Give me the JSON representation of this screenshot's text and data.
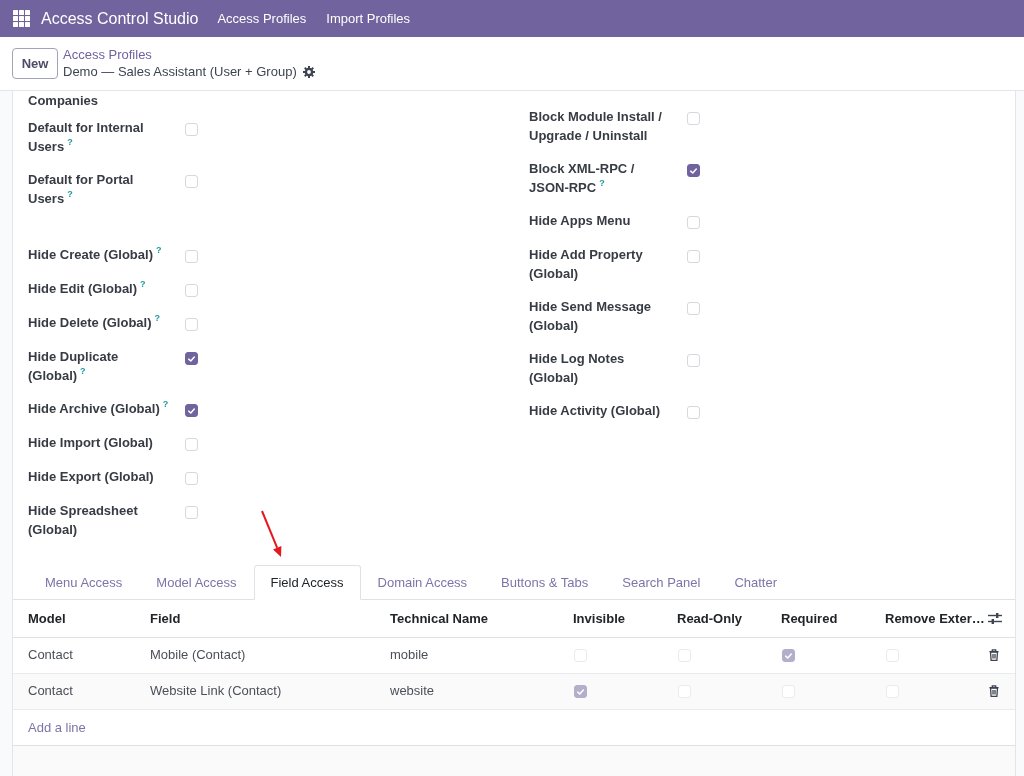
{
  "navbar": {
    "app_name": "Access Control Studio",
    "menu": [
      {
        "label": "Access Profiles"
      },
      {
        "label": "Import Profiles"
      }
    ]
  },
  "control_panel": {
    "new_button": "New",
    "breadcrumb_parent": "Access Profiles",
    "record_name": "Demo — Sales Assistant (User + Group)"
  },
  "form": {
    "left_groups": [
      {
        "fields": [
          {
            "kind": "label",
            "label": "Companies"
          },
          {
            "kind": "checkbox",
            "label": "Default for Internal Users",
            "tooltip": "?",
            "checked": false
          },
          {
            "kind": "checkbox",
            "label": "Default for Portal Users",
            "tooltip": "?",
            "checked": false
          }
        ]
      },
      {
        "fields": [
          {
            "kind": "checkbox",
            "label": "Hide Create (Global)",
            "tooltip": "?",
            "checked": false
          },
          {
            "kind": "checkbox",
            "label": "Hide Edit (Global)",
            "tooltip": "?",
            "checked": false
          },
          {
            "kind": "checkbox",
            "label": "Hide Delete (Global)",
            "tooltip": "?",
            "checked": false
          },
          {
            "kind": "checkbox",
            "label": "Hide Duplicate (Global)",
            "tooltip": "?",
            "checked": true
          },
          {
            "kind": "checkbox",
            "label": "Hide Archive (Global)",
            "tooltip": "?",
            "checked": true
          },
          {
            "kind": "checkbox",
            "label": "Hide Import (Global)",
            "checked": false
          },
          {
            "kind": "checkbox",
            "label": "Hide Export (Global)",
            "checked": false
          },
          {
            "kind": "checkbox",
            "label": "Hide Spreadsheet (Global)",
            "checked": false
          }
        ]
      }
    ],
    "right_groups": [
      {
        "fields": [
          {
            "kind": "checkbox",
            "label": "Block Module Install / Upgrade / Uninstall",
            "checked": false
          },
          {
            "kind": "checkbox",
            "label": "Block XML-RPC / JSON-RPC",
            "tooltip": "?",
            "checked": true
          },
          {
            "kind": "checkbox",
            "label": "Hide Apps Menu",
            "checked": false
          },
          {
            "kind": "checkbox",
            "label": "Hide Add Property (Global)",
            "checked": false
          },
          {
            "kind": "checkbox",
            "label": "Hide Send Message (Global)",
            "checked": false
          },
          {
            "kind": "checkbox",
            "label": "Hide Log Notes (Global)",
            "checked": false
          },
          {
            "kind": "checkbox",
            "label": "Hide Activity (Global)",
            "checked": false
          }
        ]
      }
    ]
  },
  "tabs": [
    {
      "label": "Menu Access",
      "selected": false
    },
    {
      "label": "Model Access",
      "selected": false
    },
    {
      "label": "Field Access",
      "selected": true
    },
    {
      "label": "Domain Access",
      "selected": false
    },
    {
      "label": "Buttons & Tabs",
      "selected": false
    },
    {
      "label": "Search Panel",
      "selected": false
    },
    {
      "label": "Chatter",
      "selected": false
    }
  ],
  "table": {
    "columns": [
      {
        "label": "Model",
        "kind": "text"
      },
      {
        "label": "Field",
        "kind": "text"
      },
      {
        "label": "Technical Name",
        "kind": "text"
      },
      {
        "label": "Invisible",
        "kind": "check"
      },
      {
        "label": "Read-Only",
        "kind": "check"
      },
      {
        "label": "Required",
        "kind": "check"
      },
      {
        "label": "Remove Exter…",
        "kind": "check"
      }
    ],
    "rows": [
      {
        "cells": [
          {
            "text": "Contact"
          },
          {
            "text": "Mobile (Contact)"
          },
          {
            "text": "mobile"
          },
          {
            "checked": false
          },
          {
            "checked": false
          },
          {
            "checked": true
          },
          {
            "checked": false
          }
        ]
      },
      {
        "cells": [
          {
            "text": "Contact"
          },
          {
            "text": "Website Link (Contact)"
          },
          {
            "text": "website"
          },
          {
            "checked": true
          },
          {
            "checked": false
          },
          {
            "checked": false
          },
          {
            "checked": false
          }
        ]
      }
    ],
    "add_line": "Add a line"
  },
  "annotation": {
    "kind": "arrow"
  }
}
